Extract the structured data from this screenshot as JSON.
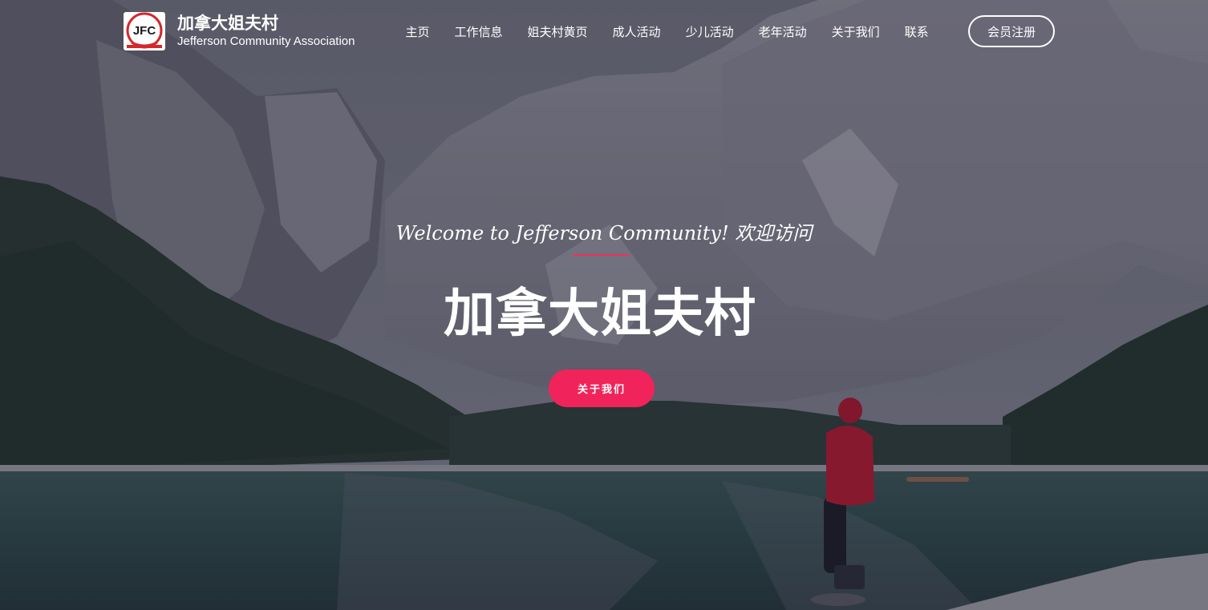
{
  "header": {
    "brand_name": "加拿大姐夫村",
    "brand_subtitle": "Jefferson Community Association",
    "logo_text": "JFC"
  },
  "nav": {
    "items": [
      {
        "label": "主页"
      },
      {
        "label": "工作信息"
      },
      {
        "label": "姐夫村黄页"
      },
      {
        "label": "成人活动"
      },
      {
        "label": "少儿活动"
      },
      {
        "label": "老年活动"
      },
      {
        "label": "关于我们"
      },
      {
        "label": "联系"
      }
    ],
    "register_label": "会员注册"
  },
  "hero": {
    "welcome_text": "Welcome to Jefferson Community! 欢迎访问",
    "title": "加拿大姐夫村",
    "button_label": "关于我们"
  },
  "colors": {
    "accent": "#f0245a",
    "text": "#ffffff"
  }
}
